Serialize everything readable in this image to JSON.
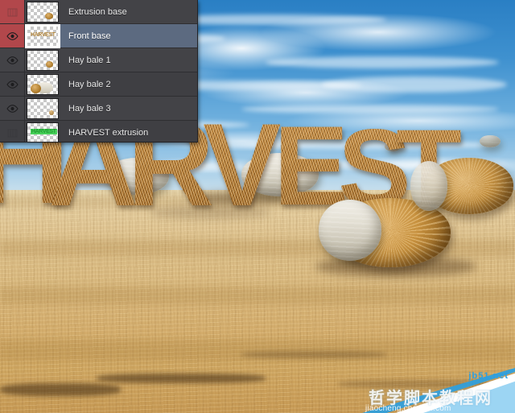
{
  "app": {
    "context": "photoshop-layers-panel-over-image"
  },
  "layers_panel": {
    "name": "Layers",
    "rows": [
      {
        "id": "extrusion-base",
        "label": "Extrusion base",
        "visible": false,
        "selected": false,
        "eye_icon": "eye-hidden-icon",
        "eye_cell_color": "#b2474b",
        "thumbnail": "extrusion-outline-thumb"
      },
      {
        "id": "front-base",
        "label": "Front base",
        "visible": true,
        "selected": true,
        "eye_icon": "eye-icon",
        "eye_cell_color": "#b2474b",
        "thumbnail": "harvest-text-thumb",
        "thumbnail_text": "HARVEST"
      },
      {
        "id": "hay-bale-1",
        "label": "Hay bale 1",
        "visible": true,
        "selected": false,
        "eye_icon": "eye-icon",
        "eye_cell_color": "#3f3f43",
        "thumbnail": "hay-bale-thumb"
      },
      {
        "id": "hay-bale-2",
        "label": "Hay bale 2",
        "visible": true,
        "selected": false,
        "eye_icon": "eye-icon",
        "eye_cell_color": "#434347",
        "thumbnail": "hay-bale-thumb"
      },
      {
        "id": "hay-bale-3",
        "label": "Hay bale 3",
        "visible": true,
        "selected": false,
        "eye_icon": "eye-icon",
        "eye_cell_color": "#3f3f43",
        "thumbnail": "hay-bale-thumb"
      },
      {
        "id": "harvest-extrusion",
        "label": "HARVEST extrusion",
        "visible": false,
        "selected": false,
        "eye_icon": "eye-hidden-icon",
        "eye_cell_color": "#434347",
        "thumbnail": "harvest-green-text-thumb",
        "thumbnail_text": "HARVEST"
      }
    ],
    "colors": {
      "panel_bg": "#3c3c3f",
      "row_bg": "#434347",
      "row_bg_alt": "#3f3f43",
      "selected_bg": "#5c6a80",
      "locked_eye_bg": "#b2474b",
      "text": "#e6e6e6"
    }
  },
  "artwork": {
    "headline": "HARVEST",
    "letters": [
      "H",
      "A",
      "R",
      "V",
      "E",
      "S",
      "T"
    ],
    "scene": "hay bales in a harvested golden stubble field under a blue sky with white clouds",
    "colors": {
      "sky_top": "#2a7fc4",
      "sky_bottom": "#d8e7ee",
      "field": "#d9b97f",
      "hay_letter": "#b27c38",
      "bale_wrap": "#e2ded2"
    }
  },
  "watermark": {
    "site": "jb51.net",
    "url": "jiaocheng.chedian.com",
    "cn_text": "哲学脚本教程网"
  }
}
